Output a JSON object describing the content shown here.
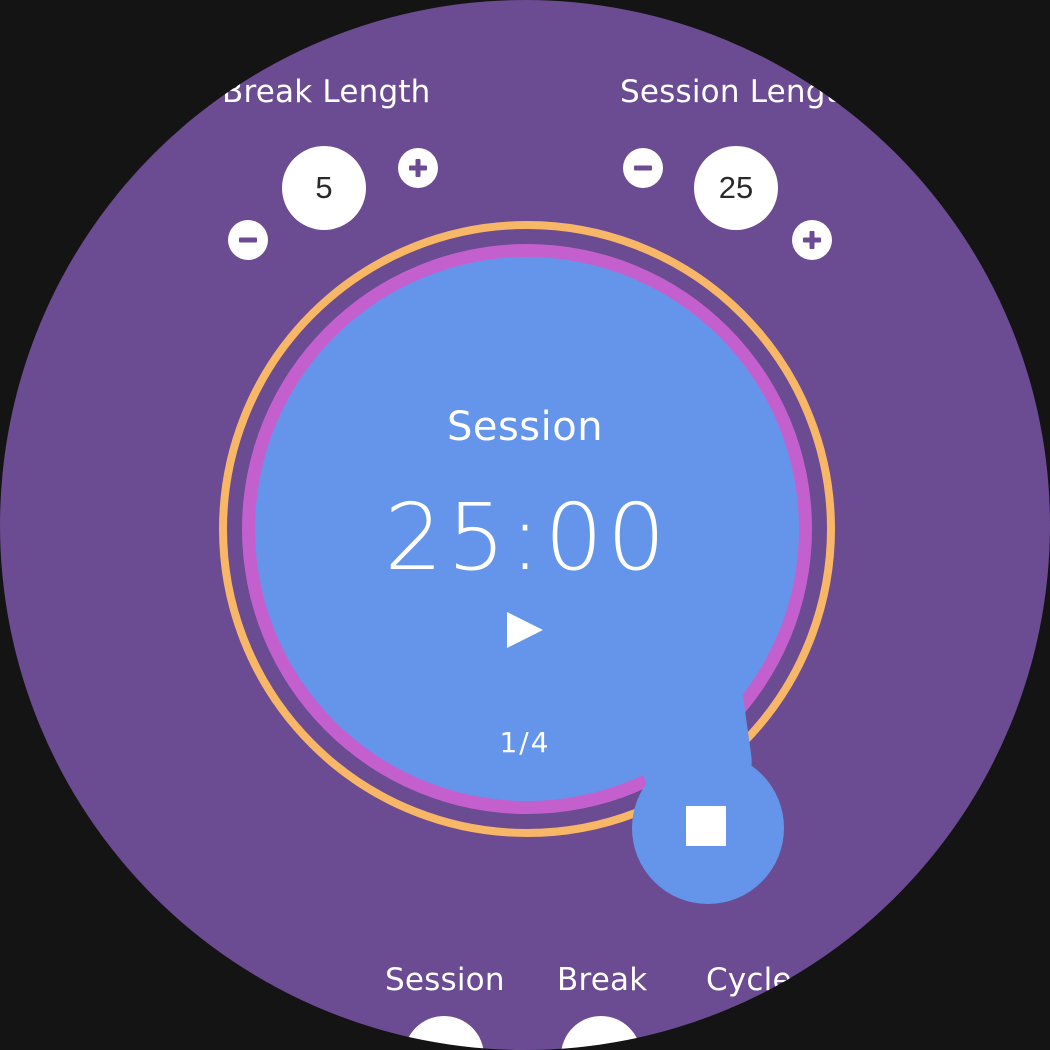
{
  "break_control": {
    "label": "Break Length",
    "value": "5",
    "decrement_icon": "minus-icon",
    "increment_icon": "plus-icon"
  },
  "session_control": {
    "label": "Session Lengt",
    "value": "25",
    "decrement_icon": "minus-icon",
    "increment_icon": "plus-icon"
  },
  "timer": {
    "mode": "Session",
    "time": "25:00",
    "cycle": "1/4",
    "play_icon": "play-icon",
    "stop_icon": "stop-icon"
  },
  "stats": {
    "labels": [
      "Session",
      "Break",
      "Cycle"
    ]
  },
  "colors": {
    "background": "#6b4b91",
    "timer_fill": "#6495ea",
    "outer_ring": "#f8b667",
    "inner_ring": "#c460ce",
    "text": "#ffffff"
  }
}
